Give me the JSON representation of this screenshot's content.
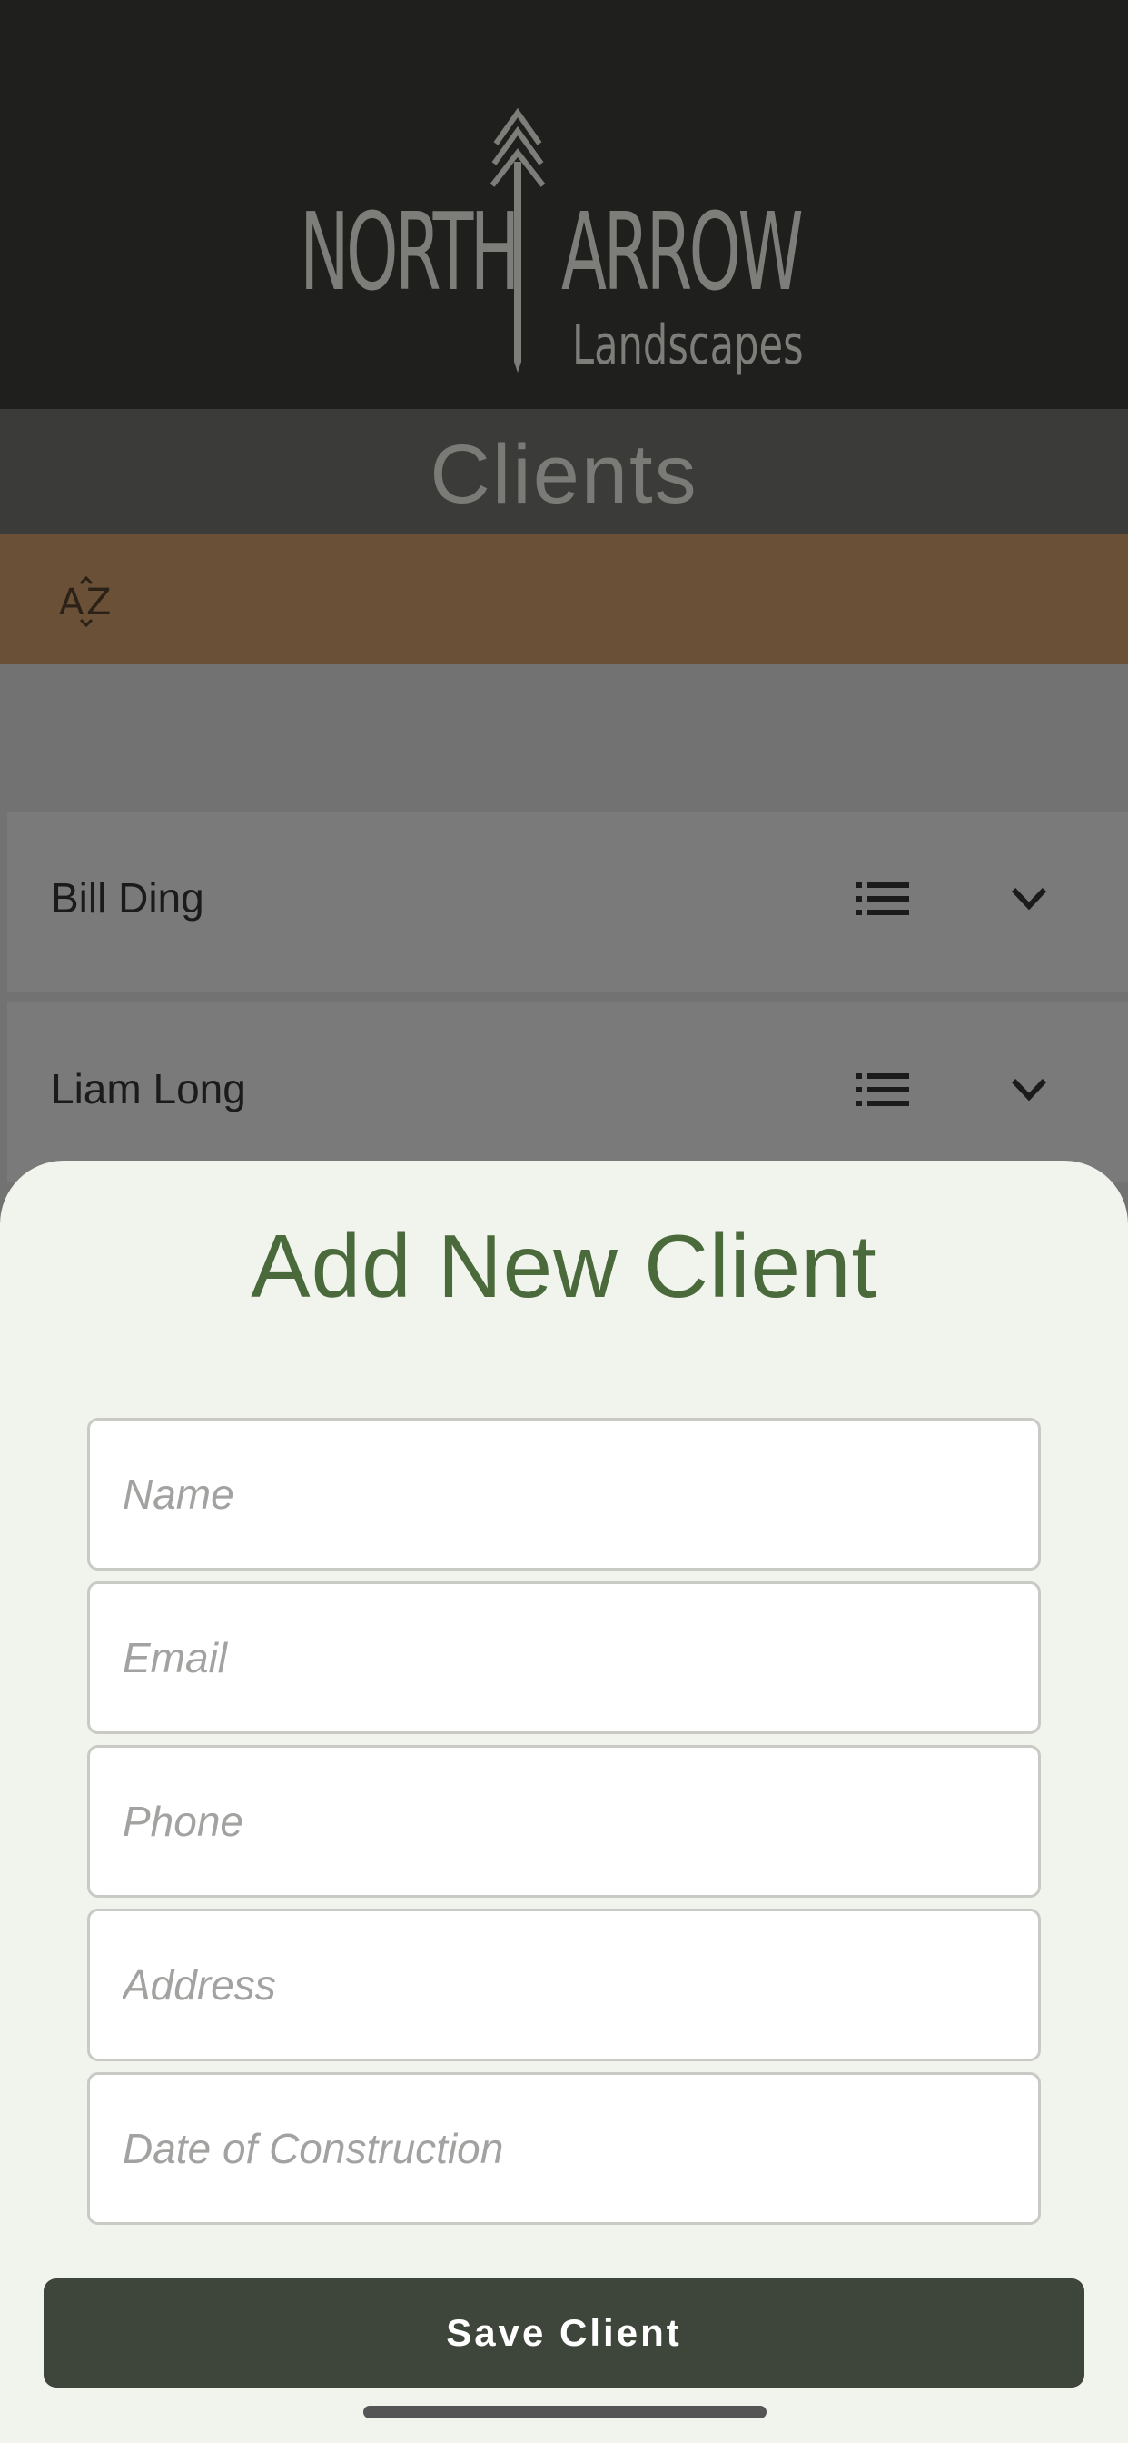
{
  "brand": {
    "logo_word_1": "NORTH",
    "logo_word_2": "ARROW",
    "logo_sub": "Landscapes"
  },
  "page": {
    "title": "Clients"
  },
  "toolbar": {
    "sort_label": "AZ",
    "sort_icon": "sort-az-icon"
  },
  "clients": [
    {
      "name": "Bill Ding",
      "details_icon": "list-icon",
      "expand_icon": "chevron-down-icon"
    },
    {
      "name": "Liam Long",
      "details_icon": "list-icon",
      "expand_icon": "chevron-down-icon"
    }
  ],
  "add_client_sheet": {
    "title": "Add New Client",
    "fields": [
      {
        "placeholder": "Name",
        "value": ""
      },
      {
        "placeholder": "Email",
        "value": ""
      },
      {
        "placeholder": "Phone",
        "value": ""
      },
      {
        "placeholder": "Address",
        "value": ""
      },
      {
        "placeholder": "Date of Construction",
        "value": ""
      }
    ],
    "save_label": "Save Client"
  },
  "colors": {
    "header_bg": "#1f201d",
    "title_bar_bg": "#3b3c39",
    "toolbar_bg": "#6a5036",
    "accent_green": "#4a6a3c",
    "button_bg": "#3e463b",
    "sheet_bg": "#f1f4ec"
  }
}
